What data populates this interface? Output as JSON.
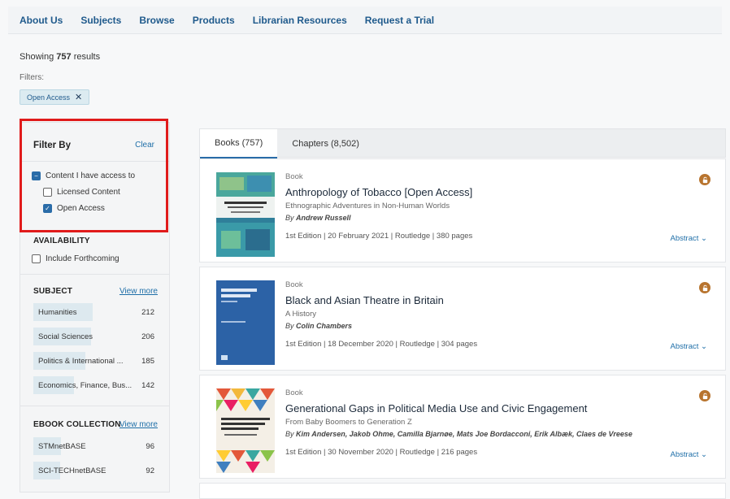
{
  "nav": [
    "About Us",
    "Subjects",
    "Browse",
    "Products",
    "Librarian Resources",
    "Request a Trial"
  ],
  "results": {
    "prefix": "Showing",
    "count": "757",
    "suffix": "results"
  },
  "filters": {
    "label": "Filters:",
    "chips": [
      "Open Access"
    ],
    "chip_close": "✕"
  },
  "sidebar": {
    "heading": "Filter By",
    "clear": "Clear",
    "access": {
      "parent": "Content I have access to",
      "children": [
        {
          "label": "Licensed Content",
          "checked": false
        },
        {
          "label": "Open Access",
          "checked": true
        }
      ]
    },
    "availability": {
      "heading": "AVAILABILITY",
      "option": "Include Forthcoming"
    },
    "subject": {
      "heading": "SUBJECT",
      "view_more": "View more",
      "items": [
        {
          "label": "Humanities",
          "count": "212",
          "fill": 0.47
        },
        {
          "label": "Social Sciences",
          "count": "206",
          "fill": 0.46
        },
        {
          "label": "Politics & International ...",
          "count": "185",
          "fill": 0.41
        },
        {
          "label": "Economics, Finance, Bus...",
          "count": "142",
          "fill": 0.32
        }
      ]
    },
    "ebook": {
      "heading": "EBOOK COLLECTION",
      "view_more": "View more",
      "items": [
        {
          "label": "STMnetBASE",
          "count": "96",
          "fill": 0.22
        },
        {
          "label": "SCI-TECHnetBASE",
          "count": "92",
          "fill": 0.21
        }
      ]
    }
  },
  "tabs": [
    {
      "label": "Books (757)",
      "active": true
    },
    {
      "label": "Chapters (8,502)",
      "active": false
    }
  ],
  "books": [
    {
      "type": "Book",
      "title": "Anthropology of Tobacco [Open Access]",
      "subtitle": "Ethnographic Adventures in Non-Human Worlds",
      "by": "By",
      "authors": "Andrew Russell",
      "meta": "1st Edition | 20 February 2021 | Routledge | 380 pages",
      "abstract": "Abstract",
      "cover_color": "#2f7f9a"
    },
    {
      "type": "Book",
      "title": "Black and Asian Theatre in Britain",
      "subtitle": "A History",
      "by": "By",
      "authors": "Colin Chambers",
      "meta": "1st Edition | 18 December 2020 | Routledge | 304 pages",
      "abstract": "Abstract",
      "cover_color": "#2c62a6"
    },
    {
      "type": "Book",
      "title": "Generational Gaps in Political Media Use and Civic Engagement",
      "subtitle": "From Baby Boomers to Generation Z",
      "by": "By",
      "authors": "Kim Andersen, Jakob Ohme, Camilla Bjarnøe, Mats Joe Bordacconi, Erik Albæk, Claes de Vreese",
      "meta": "1st Edition | 30 November 2020 | Routledge | 216 pages",
      "abstract": "Abstract",
      "cover_color": "#e3583a"
    }
  ],
  "colors": {
    "link": "#1f6fa8",
    "nav": "#1f5a8c",
    "lock": "#b8742e",
    "highlight": "#e01b1b"
  }
}
